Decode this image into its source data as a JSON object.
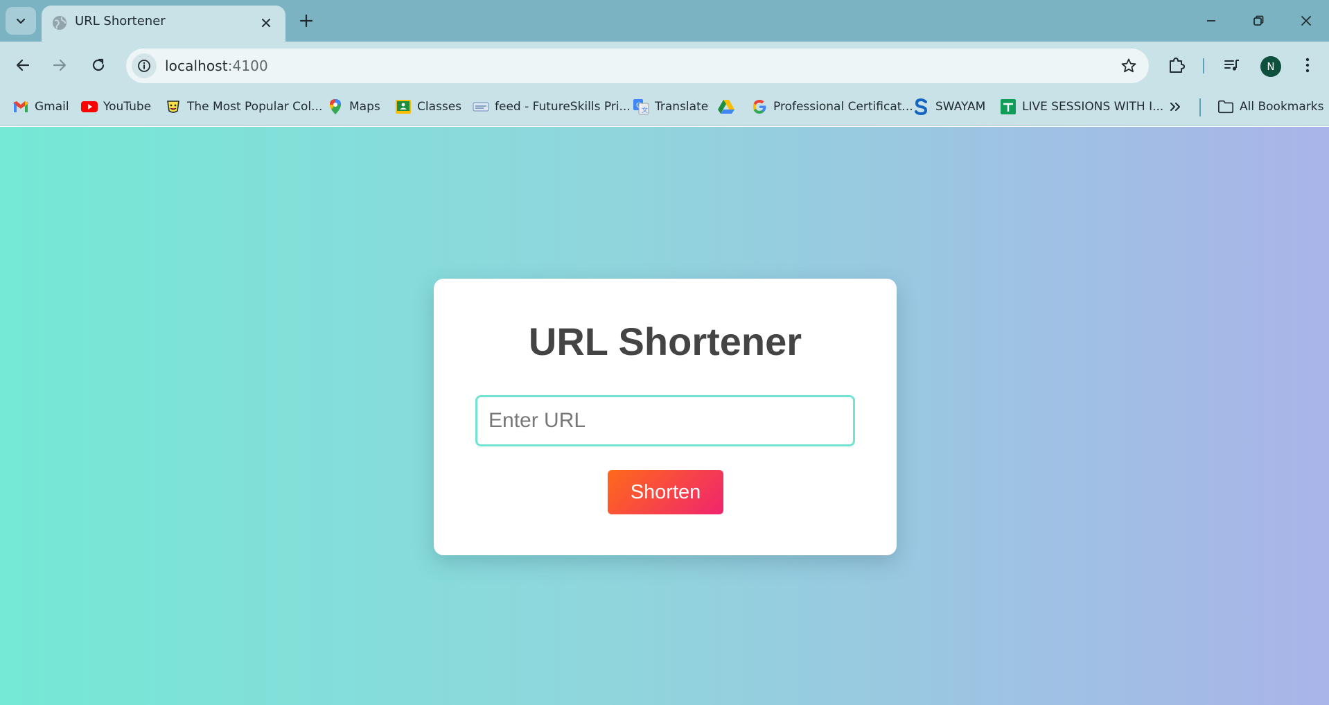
{
  "browser": {
    "tab": {
      "title": "URL Shortener"
    },
    "address": {
      "host": "localhost",
      "port": ":4100"
    },
    "profile_initial": "N",
    "bookmarks": [
      {
        "label": "Gmail",
        "icon": "gmail-icon"
      },
      {
        "label": "YouTube",
        "icon": "youtube-icon"
      },
      {
        "label": "The Most Popular Col...",
        "icon": "popular-icon"
      },
      {
        "label": "Maps",
        "icon": "maps-icon"
      },
      {
        "label": "Classes",
        "icon": "classes-icon"
      },
      {
        "label": "feed - FutureSkills Pri...",
        "icon": "futureskills-icon"
      },
      {
        "label": "Translate",
        "icon": "translate-icon"
      },
      {
        "label": "",
        "icon": "drive-icon"
      },
      {
        "label": "Professional Certificat...",
        "icon": "google-icon"
      },
      {
        "label": "SWAYAM",
        "icon": "swayam-icon"
      },
      {
        "label": "LIVE SESSIONS WITH I...",
        "icon": "sheets-icon"
      }
    ],
    "all_bookmarks_label": "All Bookmarks"
  },
  "page": {
    "title": "URL Shortener",
    "input": {
      "placeholder": "Enter URL",
      "value": ""
    },
    "button_label": "Shorten",
    "colors": {
      "gradient_start": "#75e8d6",
      "gradient_end": "#a9b4e8",
      "button_start": "#ff6a1a",
      "button_end": "#f0246e",
      "input_border": "#72e2d2"
    }
  }
}
